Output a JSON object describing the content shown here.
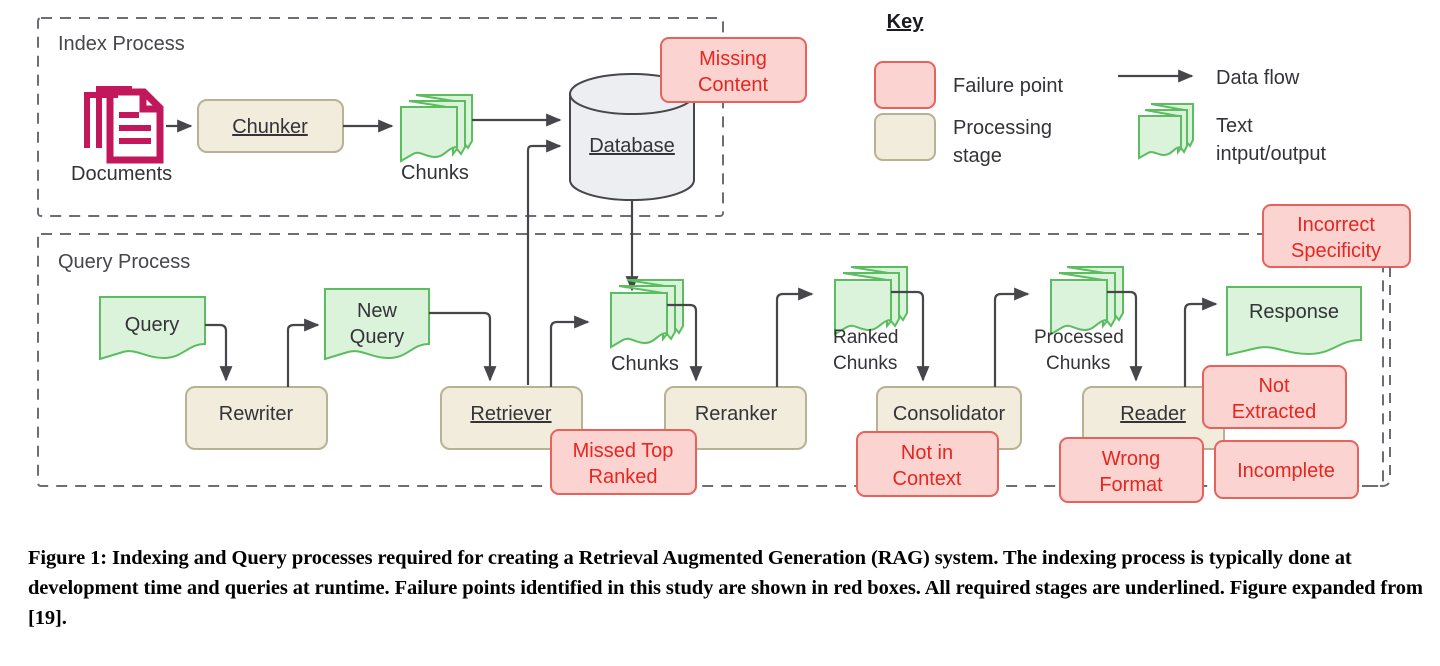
{
  "figure": {
    "caption": "Figure 1: Indexing and Query processes required for creating a Retrieval Augmented Generation (RAG) system. The indexing process is typically done at development time and queries at runtime. Failure points identified in this study are shown in red boxes. All required stages are underlined. Figure expanded from [19]."
  },
  "groups": {
    "index_process": "Index Process",
    "query_process": "Query Process"
  },
  "index_process": {
    "documents_label": "Documents",
    "chunker": "Chunker",
    "chunks": "Chunks",
    "database": "Database",
    "missing_content": "Missing\nContent",
    "missing_content_line1": "Missing",
    "missing_content_line2": "Content"
  },
  "query_process": {
    "query": "Query",
    "rewriter": "Rewriter",
    "new_query_line1": "New",
    "new_query_line2": "Query",
    "retriever": "Retriever",
    "chunks": "Chunks",
    "reranker": "Reranker",
    "ranked_chunks_line1": "Ranked",
    "ranked_chunks_line2": "Chunks",
    "consolidator": "Consolidator",
    "processed_chunks_line1": "Processed",
    "processed_chunks_line2": "Chunks",
    "reader": "Reader",
    "response": "Response"
  },
  "failure_points": {
    "missing_content": [
      "Missing",
      "Content"
    ],
    "missed_top_ranked": [
      "Missed Top",
      "Ranked"
    ],
    "not_in_context": [
      "Not in",
      "Context"
    ],
    "incorrect_specificity": [
      "Incorrect",
      "Specificity"
    ],
    "not_extracted": [
      "Not",
      "Extracted"
    ],
    "wrong_format": [
      "Wrong",
      "Format"
    ],
    "incomplete": [
      "Incomplete"
    ]
  },
  "key": {
    "title": "Key",
    "failure_point": "Failure point",
    "processing_stage_line1": "Processing",
    "processing_stage_line2": "stage",
    "data_flow": "Data flow",
    "text_io_line1": "Text",
    "text_io_line2": "intput/output"
  },
  "colors": {
    "failure_fill": "#fbd4d2",
    "failure_stroke": "#e8625c",
    "failure_text": "#e8251e",
    "stage_fill": "#f1ecdc",
    "stage_stroke": "#b9b193",
    "text_fill": "#dbf2db",
    "text_stroke": "#5cbd60",
    "database_fill": "#eceef1",
    "database_stroke": "#46464b",
    "documents": "#c2185b",
    "arrow": "#46464b",
    "dashed_border": "#6d6d75"
  }
}
